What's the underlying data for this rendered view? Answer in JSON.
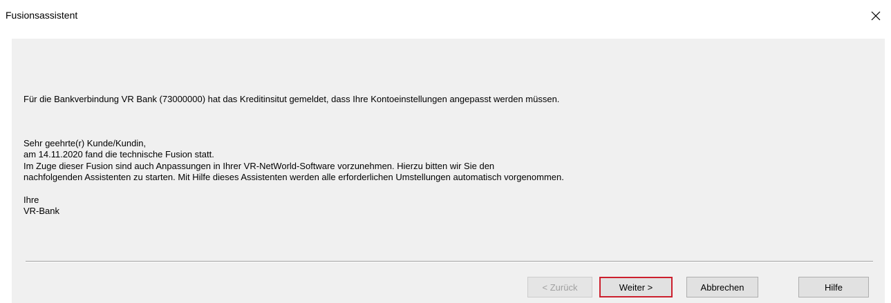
{
  "window": {
    "title": "Fusionsassistent"
  },
  "message": {
    "intro": "Für die Bankverbindung VR Bank (73000000) hat das Kreditinsitut gemeldet, dass Ihre Kontoeinstellungen angepasst werden  müssen.",
    "greeting": "Sehr geehrte(r) Kunde/Kundin,",
    "line1": "am 14.11.2020 fand die technische Fusion statt.",
    "line2": "Im Zuge dieser Fusion sind auch Anpassungen in Ihrer VR-NetWorld-Software vorzunehmen. Hierzu bitten wir Sie den",
    "line3": "nachfolgenden Assistenten zu starten. Mit Hilfe dieses Assistenten werden alle erforderlichen Umstellungen automatisch vorgenommen.",
    "closing": "Ihre",
    "signature": "VR-Bank"
  },
  "buttons": {
    "back": "< Zurück",
    "next": "Weiter >",
    "cancel": "Abbrechen",
    "help": "Hilfe"
  },
  "icons": {
    "close": "close-icon"
  },
  "colors": {
    "panel_background": "#f0f0f0",
    "focus_highlight": "#cc1f2d",
    "disabled_text": "#a0a0a0"
  }
}
